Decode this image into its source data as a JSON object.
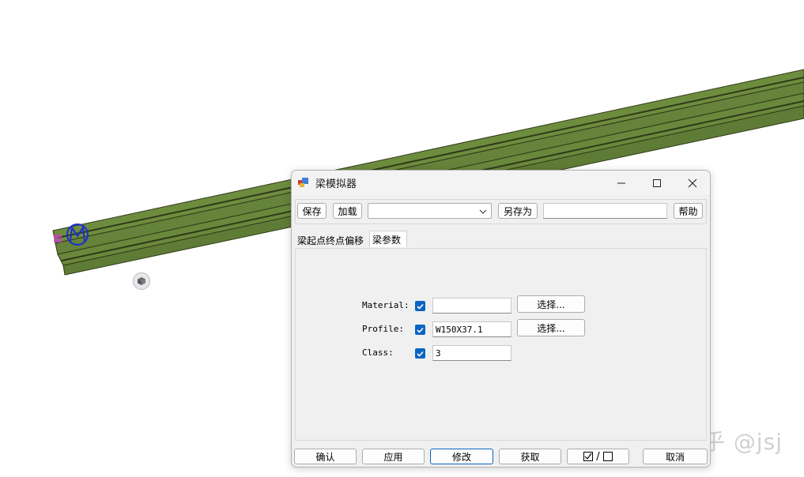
{
  "dialog": {
    "title": "梁模拟器",
    "window_controls": {
      "minimize": "minimize-icon",
      "maximize": "maximize-icon",
      "close": "close-icon"
    }
  },
  "toolbar": {
    "save_label": "保存",
    "load_label": "加载",
    "preset_value": "",
    "save_as_label": "另存为",
    "save_as_name": "",
    "help_label": "帮助"
  },
  "tabs": [
    {
      "label": "梁起点终点偏移",
      "active": false
    },
    {
      "label": "梁参数",
      "active": true
    }
  ],
  "fields": {
    "material": {
      "label": "Material:",
      "checked": true,
      "value": "",
      "button": "选择..."
    },
    "profile": {
      "label": "Profile:",
      "checked": true,
      "value": "W150X37.1",
      "button": "选择..."
    },
    "class": {
      "label": "Class:",
      "checked": true,
      "value": "3"
    }
  },
  "bottom_buttons": {
    "ok": "确认",
    "apply": "应用",
    "modify": "修改",
    "get": "获取",
    "toggle_separator": "/",
    "cancel": "取消"
  },
  "watermark": "知乎 @jsj",
  "colors": {
    "beam": "#6e8c3e",
    "accent": "#0b64c2",
    "handle": "#1a2fd0",
    "marker": "#d33ad3"
  }
}
